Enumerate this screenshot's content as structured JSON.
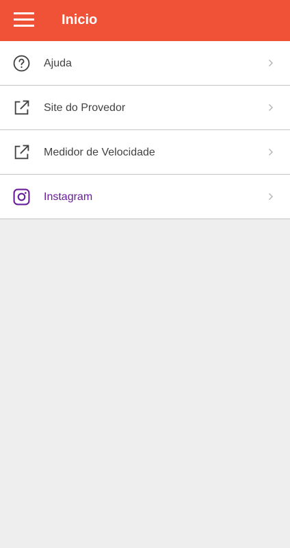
{
  "appbar": {
    "title": "Inicio",
    "menu_icon": "hamburger-menu-icon",
    "color": "#f05237"
  },
  "list": {
    "items": [
      {
        "label": "Ajuda",
        "icon": "help-circle-icon",
        "color": "#424242"
      },
      {
        "label": "Site do Provedor",
        "icon": "external-link-icon",
        "color": "#424242"
      },
      {
        "label": "Medidor de Velocidade",
        "icon": "external-link-icon",
        "color": "#424242"
      },
      {
        "label": "Instagram",
        "icon": "instagram-icon",
        "color": "#6a1b9a"
      }
    ]
  }
}
